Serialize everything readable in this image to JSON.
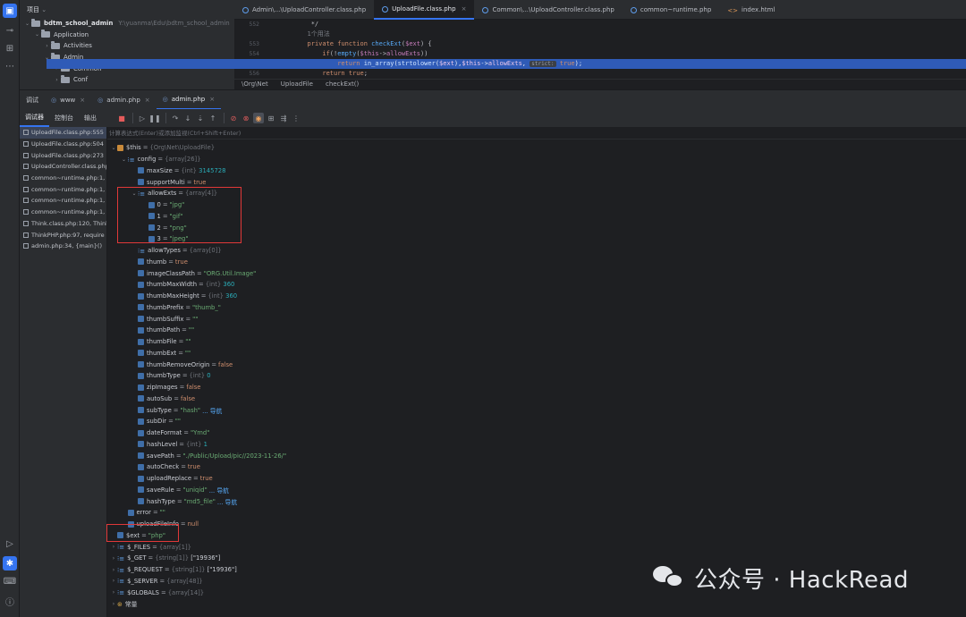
{
  "project": {
    "title": "项目",
    "tree": [
      {
        "label": "bdtm_school_admin",
        "path": "Y:\\yuanma\\Edu\\bdtm_school_admin",
        "depth": 0,
        "chevron": "down",
        "bold": true
      },
      {
        "label": "Application",
        "path": "",
        "depth": 1,
        "chevron": "down"
      },
      {
        "label": "Activities",
        "path": "",
        "depth": 2,
        "chevron": "right"
      },
      {
        "label": "Admin",
        "path": "",
        "depth": 2,
        "chevron": "down"
      },
      {
        "label": "Common",
        "path": "",
        "depth": 3,
        "chevron": "right"
      },
      {
        "label": "Conf",
        "path": "",
        "depth": 3,
        "chevron": "right"
      }
    ]
  },
  "editor": {
    "tabs": [
      {
        "label": "Admin\\...\\UploadController.class.php",
        "active": false,
        "icon": "php"
      },
      {
        "label": "UploadFile.class.php",
        "active": true,
        "icon": "php"
      },
      {
        "label": "Common\\...\\UploadController.class.php",
        "active": false,
        "icon": "php"
      },
      {
        "label": "common~runtime.php",
        "active": false,
        "icon": "php"
      },
      {
        "label": "index.html",
        "active": false,
        "icon": "html"
      }
    ],
    "line_numbers": [
      "552",
      "",
      "553",
      "554",
      "555",
      "556"
    ],
    "usage_hint": "1个用法",
    "inlay_hint": "strict:",
    "breadcrumb": [
      "\\Org\\Net",
      "UploadFile",
      "checkExt()"
    ]
  },
  "debug": {
    "tabs": [
      {
        "label": "调试",
        "icon": "",
        "active": false,
        "closable": false
      },
      {
        "label": "www",
        "icon": "php",
        "active": false,
        "closable": true
      },
      {
        "label": "admin.php",
        "icon": "php",
        "active": false,
        "closable": true
      },
      {
        "label": "admin.php",
        "icon": "php",
        "active": true,
        "closable": true
      }
    ],
    "subtabs": [
      {
        "label": "调试器",
        "active": true
      },
      {
        "label": "控制台",
        "active": false
      },
      {
        "label": "输出",
        "active": false
      }
    ],
    "eval_placeholder": "计算表达式(Enter)或添加监视(Ctrl+Shift+Enter)",
    "frames": [
      "UploadFile.class.php:555",
      "UploadFile.class.php:504",
      "UploadFile.class.php:273",
      "UploadController.class.php",
      "common~runtime.php:1,",
      "common~runtime.php:1,",
      "common~runtime.php:1,",
      "common~runtime.php:1,",
      "Think.class.php:120, Think",
      "ThinkPHP.php:97, require",
      "admin.php:34, {main}()"
    ],
    "variables": [
      {
        "d": 0,
        "c": "v",
        "icon": "obj",
        "name": "$this",
        "type": "{Org\\Net\\UploadFile}"
      },
      {
        "d": 1,
        "c": "v",
        "icon": "arr",
        "name": "config",
        "type": "{array[26]}"
      },
      {
        "d": 2,
        "c": "",
        "icon": "box",
        "name": "maxSize",
        "type": "{int}",
        "value": "3145728",
        "vk": "num"
      },
      {
        "d": 2,
        "c": "",
        "icon": "box",
        "name": "supportMulti",
        "value": "true",
        "vk": "kw"
      },
      {
        "d": 2,
        "c": "v",
        "icon": "arr",
        "name": "allowExts",
        "type": "{array[4]}"
      },
      {
        "d": 3,
        "c": "",
        "icon": "box",
        "name": "0",
        "value": "\"jpg\"",
        "vk": "str"
      },
      {
        "d": 3,
        "c": "",
        "icon": "box",
        "name": "1",
        "value": "\"gif\"",
        "vk": "str"
      },
      {
        "d": 3,
        "c": "",
        "icon": "box",
        "name": "2",
        "value": "\"png\"",
        "vk": "str"
      },
      {
        "d": 3,
        "c": "",
        "icon": "box",
        "name": "3",
        "value": "\"jpeg\"",
        "vk": "str"
      },
      {
        "d": 2,
        "c": "",
        "icon": "arr",
        "name": "allowTypes",
        "type": "{array[0]}"
      },
      {
        "d": 2,
        "c": "",
        "icon": "box",
        "name": "thumb",
        "value": "true",
        "vk": "kw"
      },
      {
        "d": 2,
        "c": "",
        "icon": "box",
        "name": "imageClassPath",
        "value": "\"ORG.Util.Image\"",
        "vk": "str"
      },
      {
        "d": 2,
        "c": "",
        "icon": "box",
        "name": "thumbMaxWidth",
        "type": "{int}",
        "value": "360",
        "vk": "num"
      },
      {
        "d": 2,
        "c": "",
        "icon": "box",
        "name": "thumbMaxHeight",
        "type": "{int}",
        "value": "360",
        "vk": "num"
      },
      {
        "d": 2,
        "c": "",
        "icon": "box",
        "name": "thumbPrefix",
        "value": "\"thumb_\"",
        "vk": "str"
      },
      {
        "d": 2,
        "c": "",
        "icon": "box",
        "name": "thumbSuffix",
        "value": "\"\"",
        "vk": "str"
      },
      {
        "d": 2,
        "c": "",
        "icon": "box",
        "name": "thumbPath",
        "value": "\"\"",
        "vk": "str"
      },
      {
        "d": 2,
        "c": "",
        "icon": "box",
        "name": "thumbFile",
        "value": "\"\"",
        "vk": "str"
      },
      {
        "d": 2,
        "c": "",
        "icon": "box",
        "name": "thumbExt",
        "value": "\"\"",
        "vk": "str"
      },
      {
        "d": 2,
        "c": "",
        "icon": "box",
        "name": "thumbRemoveOrigin",
        "value": "false",
        "vk": "kw"
      },
      {
        "d": 2,
        "c": "",
        "icon": "box",
        "name": "thumbType",
        "type": "{int}",
        "value": "0",
        "vk": "num"
      },
      {
        "d": 2,
        "c": "",
        "icon": "box",
        "name": "zipImages",
        "value": "false",
        "vk": "kw"
      },
      {
        "d": 2,
        "c": "",
        "icon": "box",
        "name": "autoSub",
        "value": "false",
        "vk": "kw"
      },
      {
        "d": 2,
        "c": "",
        "icon": "box",
        "name": "subType",
        "value": "\"hash\"",
        "vk": "str",
        "nav": "... 导航"
      },
      {
        "d": 2,
        "c": "",
        "icon": "box",
        "name": "subDir",
        "value": "\"\"",
        "vk": "str"
      },
      {
        "d": 2,
        "c": "",
        "icon": "box",
        "name": "dateFormat",
        "value": "\"Ymd\"",
        "vk": "str"
      },
      {
        "d": 2,
        "c": "",
        "icon": "box",
        "name": "hashLevel",
        "type": "{int}",
        "value": "1",
        "vk": "num"
      },
      {
        "d": 2,
        "c": "",
        "icon": "box",
        "name": "savePath",
        "value": "\"./Public/Upload/pic//2023-11-26/\"",
        "vk": "str"
      },
      {
        "d": 2,
        "c": "",
        "icon": "box",
        "name": "autoCheck",
        "value": "true",
        "vk": "kw"
      },
      {
        "d": 2,
        "c": "",
        "icon": "box",
        "name": "uploadReplace",
        "value": "true",
        "vk": "kw"
      },
      {
        "d": 2,
        "c": "",
        "icon": "box",
        "name": "saveRule",
        "value": "\"uniqid\"",
        "vk": "str",
        "nav": "... 导航"
      },
      {
        "d": 2,
        "c": "",
        "icon": "box",
        "name": "hashType",
        "value": "\"md5_file\"",
        "vk": "str",
        "nav": "... 导航"
      },
      {
        "d": 1,
        "c": "",
        "icon": "box",
        "name": "error",
        "value": "\"\"",
        "vk": "str"
      },
      {
        "d": 1,
        "c": "",
        "icon": "box",
        "name": "uploadFileInfo",
        "value": "null",
        "vk": "kw"
      },
      {
        "d": 0,
        "c": "",
        "icon": "box",
        "name": "$ext",
        "value": "\"php\"",
        "vk": "str"
      },
      {
        "d": 0,
        "c": ">",
        "icon": "arr",
        "name": "$_FILES",
        "type": "{array[1]}"
      },
      {
        "d": 0,
        "c": ">",
        "icon": "arr",
        "name": "$_GET",
        "type": "{string[1]}",
        "value": "[\"19936\"]",
        "vk": "val"
      },
      {
        "d": 0,
        "c": ">",
        "icon": "arr",
        "name": "$_REQUEST",
        "type": "{string[1]}",
        "value": "[\"19936\"]",
        "vk": "val"
      },
      {
        "d": 0,
        "c": ">",
        "icon": "arr",
        "name": "$_SERVER",
        "type": "{array[48]}"
      },
      {
        "d": 0,
        "c": ">",
        "icon": "arr",
        "name": "$GLOBALS",
        "type": "{array[14]}"
      },
      {
        "d": 0,
        "c": ">",
        "icon": "const",
        "name": "常量"
      }
    ]
  },
  "watermark": {
    "text": "公众号 · HackRead"
  }
}
